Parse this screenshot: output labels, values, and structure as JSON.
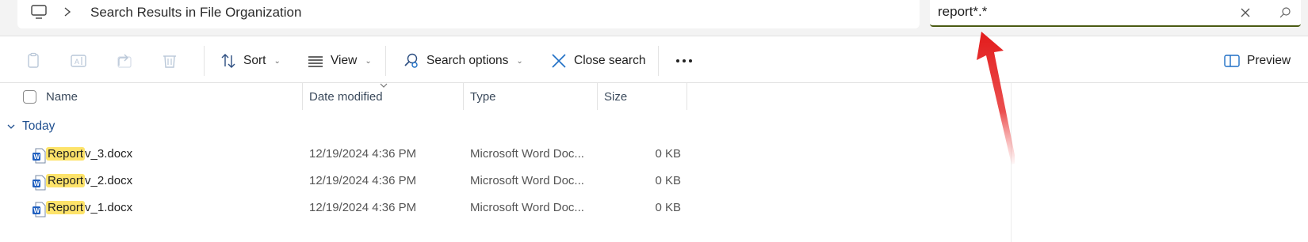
{
  "address_bar": {
    "location": "Search Results in File Organization"
  },
  "search": {
    "value": "report*.*",
    "clear_icon": "close-icon",
    "search_icon": "search-icon"
  },
  "command_bar": {
    "sort_label": "Sort",
    "view_label": "View",
    "search_options_label": "Search options",
    "close_search_label": "Close search",
    "preview_label": "Preview"
  },
  "columns": {
    "name": "Name",
    "date_modified": "Date modified",
    "type": "Type",
    "size": "Size"
  },
  "group": {
    "label": "Today"
  },
  "files": [
    {
      "highlight": "Report",
      "rest": "v_3.docx",
      "date": "12/19/2024 4:36 PM",
      "type": "Microsoft Word Doc...",
      "size": "0 KB"
    },
    {
      "highlight": "Report",
      "rest": "v_2.docx",
      "date": "12/19/2024 4:36 PM",
      "type": "Microsoft Word Doc...",
      "size": "0 KB"
    },
    {
      "highlight": "Report",
      "rest": "v_1.docx",
      "date": "12/19/2024 4:36 PM",
      "type": "Microsoft Word Doc...",
      "size": "0 KB"
    }
  ],
  "colors": {
    "search_underline": "#4a5a13",
    "highlight": "#fde36a",
    "accent_blue": "#1f6fc5",
    "arrow_red": "#e21b1b"
  }
}
